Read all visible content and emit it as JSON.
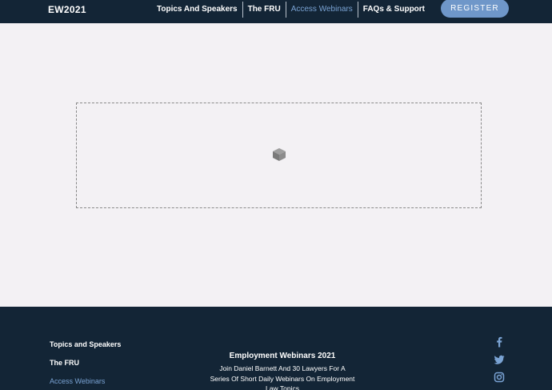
{
  "header": {
    "brand": "EW2021",
    "nav": [
      {
        "label": "Topics And Speakers",
        "active": false
      },
      {
        "label": "The FRU",
        "active": false
      },
      {
        "label": "Access Webinars",
        "active": true
      },
      {
        "label": "FAQs & Support",
        "active": false
      }
    ],
    "register_label": "REGISTER"
  },
  "main": {
    "placeholder_icon": "cube-icon"
  },
  "footer": {
    "nav": [
      {
        "label": "Topics and Speakers",
        "active": false
      },
      {
        "label": "The FRU",
        "active": false
      },
      {
        "label": "Access Webinars",
        "active": true
      }
    ],
    "title": "Employment Webinars 2021",
    "description": "Join Daniel Barnett And 30 Lawyers For A Series Of Short Daily Webinars On Employment Law Topics",
    "social": [
      "facebook-icon",
      "twitter-icon",
      "instagram-icon"
    ]
  },
  "colors": {
    "navy": "#132536",
    "accent": "#6f97c9",
    "active_link": "#7aa3d4",
    "page_bg": "#f3f1f4"
  }
}
